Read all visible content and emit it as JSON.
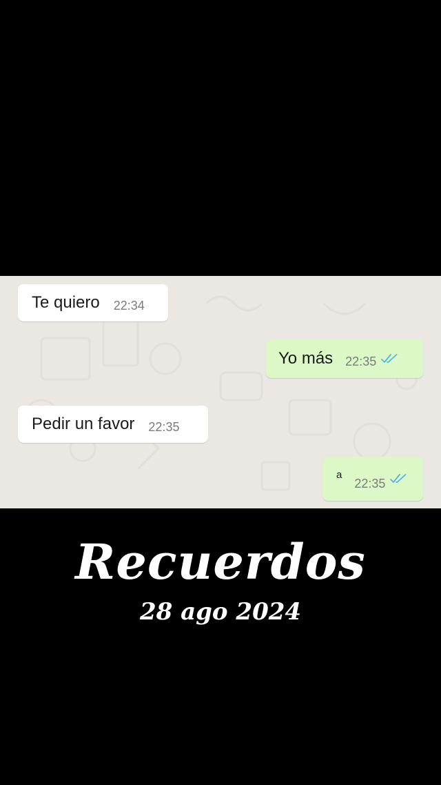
{
  "colors": {
    "page_background": "#000000",
    "chat_background": "#ebe7e2",
    "incoming_bubble": "#ffffff",
    "outgoing_bubble": "#dcf8c6",
    "read_ticks": "#4fb6ec",
    "caption_text": "#ffffff"
  },
  "chat": {
    "messages": [
      {
        "direction": "incoming",
        "text": "Te quiero",
        "time": "22:34"
      },
      {
        "direction": "outgoing",
        "text": "Yo más",
        "time": "22:35",
        "status_icon": "double-check-read-icon"
      },
      {
        "direction": "incoming",
        "text": "Pedir un favor",
        "time": "22:35"
      },
      {
        "direction": "outgoing",
        "text": "a",
        "time": "22:35",
        "status_icon": "double-check-read-icon"
      }
    ]
  },
  "caption": {
    "title": "Recuerdos",
    "date": "28 ago 2024"
  }
}
